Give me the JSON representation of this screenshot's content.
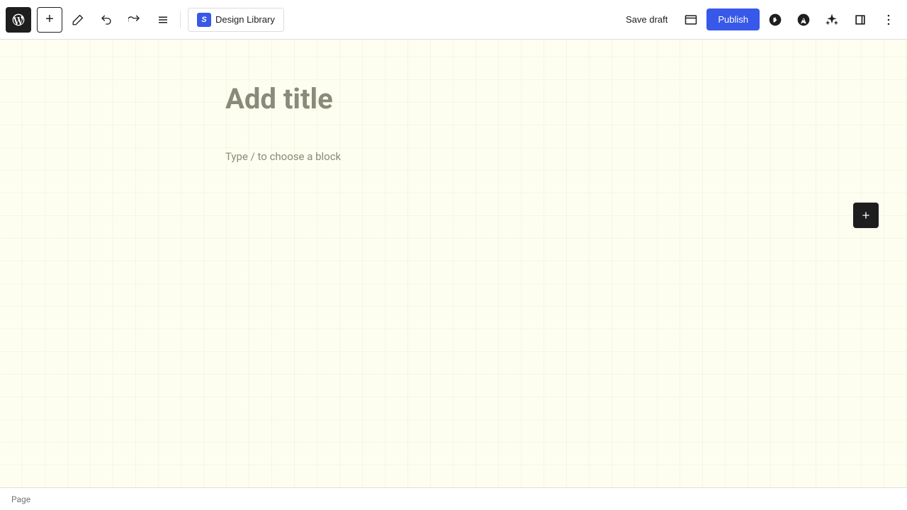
{
  "toolbar": {
    "add_button_label": "+",
    "design_library_label": "Design Library",
    "design_library_icon": "S",
    "save_draft_label": "Save draft",
    "publish_label": "Publish",
    "status_label": "Page"
  },
  "editor": {
    "title_placeholder": "Add title",
    "block_placeholder": "Type / to choose a block"
  },
  "icons": {
    "add": "+",
    "pencil": "✏",
    "undo": "↩",
    "redo": "↪",
    "list": "≡",
    "preview": "⬜",
    "jetpack": "⚡",
    "akismet": "🅐",
    "sparkle": "✦",
    "sidebar": "▦",
    "more": "⋯"
  }
}
